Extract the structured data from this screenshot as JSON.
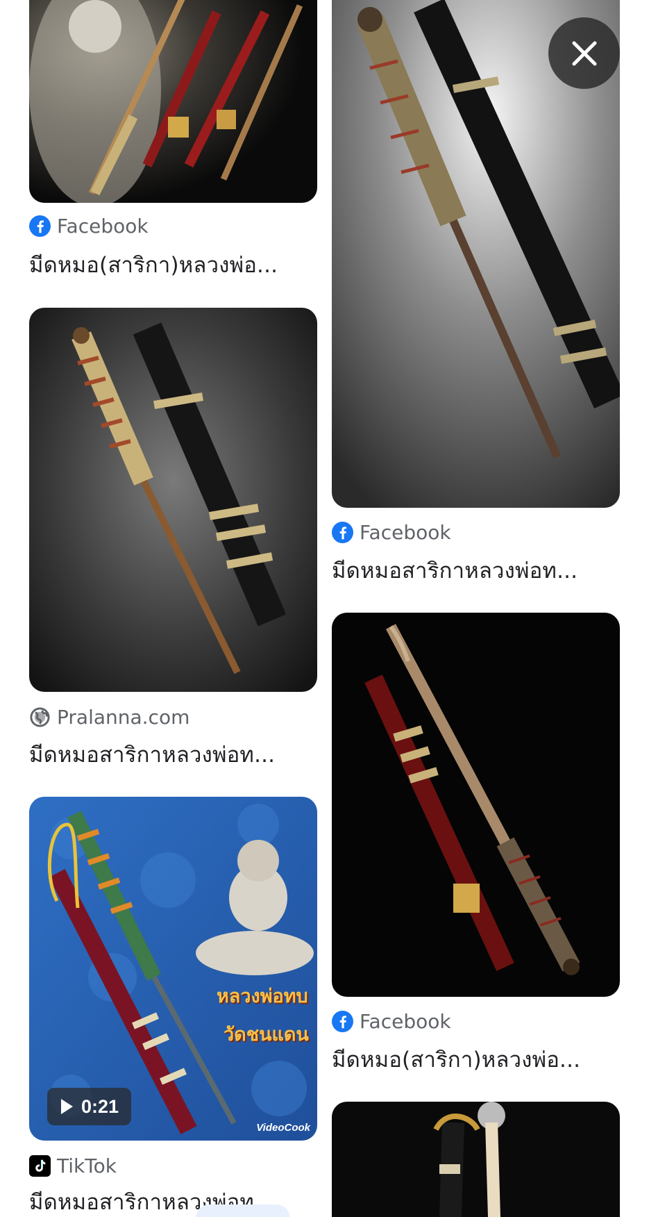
{
  "results": {
    "left": [
      {
        "source": "Facebook",
        "source_icon": "facebook-icon",
        "title": "มีดหมอ(สาริกา)หลวงพ่อ..."
      },
      {
        "source": "Pralanna.com",
        "source_icon": "globe-icon",
        "title": "มีดหมอสาริกาหลวงพ่อท..."
      },
      {
        "source": "TikTok",
        "source_icon": "tiktok-icon",
        "title": "มีดหมอสาริกาหลวงพ่อท...",
        "video_duration": "0:21",
        "image_text_line1": "หลวงพ่อทบ",
        "image_text_line2": "วัดชนแดน",
        "watermark": "VideoCook"
      }
    ],
    "right": [
      {
        "source": "Facebook",
        "source_icon": "facebook-icon",
        "title": "มีดหมอสาริกาหลวงพ่อท..."
      },
      {
        "source": "Facebook",
        "source_icon": "facebook-icon",
        "title": "มีดหมอ(สาริกา)หลวงพ่อ..."
      }
    ]
  },
  "close_icon": "close-icon",
  "colors": {
    "facebook": "#1877f2",
    "text_primary": "#202124",
    "text_secondary": "#5f6368"
  }
}
